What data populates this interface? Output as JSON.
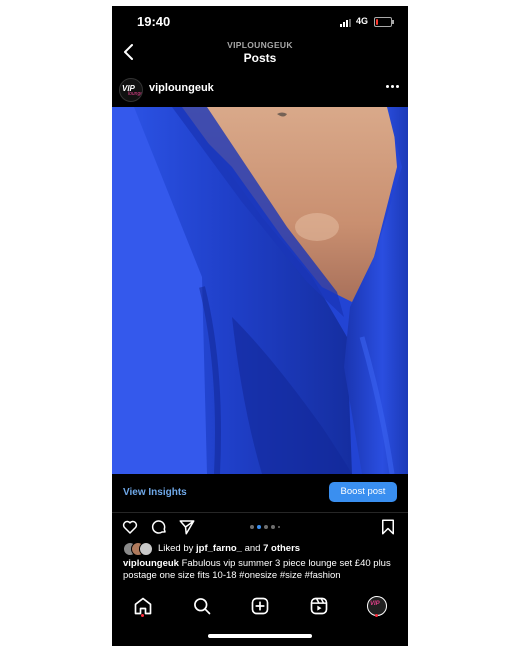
{
  "status_bar": {
    "time": "19:40",
    "network": "4G",
    "battery_level": 0.15,
    "battery_color": "#ff3b30"
  },
  "navbar": {
    "account": "VIPLOUNGEUK",
    "title": "Posts"
  },
  "post": {
    "username": "viploungeuk",
    "avatar_text": "VIP",
    "avatar_subtext": "lounge",
    "insights_label": "View Insights",
    "boost_label": "Boost post",
    "carousel": {
      "count": 5,
      "active_index": 1
    },
    "likes": {
      "prefix": "Liked by ",
      "user": "jpf_farno_",
      "middle": " and ",
      "others": "7 others"
    },
    "caption": {
      "username": "viploungeuk",
      "text": " Fabulous vip summer 3 piece lounge set £40 plus postage one size fits 10-18 #onesize #size #fashion"
    }
  },
  "colors": {
    "accent_blue": "#3a8ff0",
    "link_blue": "#6fa8e8",
    "notification_red": "#ff3040",
    "fabric_blue": "#2546d6"
  },
  "icons": {
    "action_bar": [
      "heart-icon",
      "comment-icon",
      "share-icon",
      "bookmark-icon"
    ],
    "tab_bar": [
      "home-icon",
      "search-icon",
      "create-icon",
      "reels-icon",
      "profile-avatar"
    ]
  }
}
